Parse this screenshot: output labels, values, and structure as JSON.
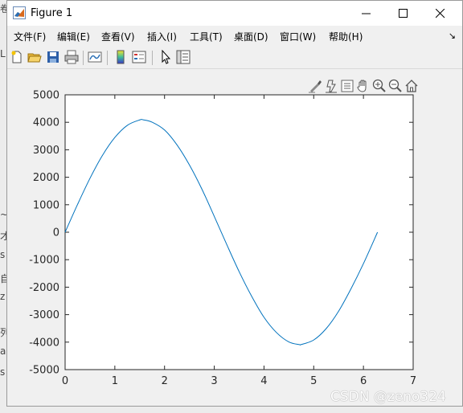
{
  "window": {
    "title": "Figure 1"
  },
  "menu": [
    {
      "label": "文件(F)"
    },
    {
      "label": "编辑(E)"
    },
    {
      "label": "查看(V)"
    },
    {
      "label": "插入(I)"
    },
    {
      "label": "工具(T)"
    },
    {
      "label": "桌面(D)"
    },
    {
      "label": "窗口(W)"
    },
    {
      "label": "帮助(H)"
    }
  ],
  "toolbar_icons": [
    "new-figure-icon",
    "open-file-icon",
    "save-icon",
    "print-icon",
    "link-plot-icon",
    "insert-colorbar-icon",
    "insert-legend-icon",
    "pointer-icon",
    "property-inspector-icon"
  ],
  "axes_toolbar_icons": [
    "brush-icon",
    "data-tips-icon",
    "restore-view-icon",
    "pan-icon",
    "zoom-in-icon",
    "zoom-out-icon",
    "home-icon"
  ],
  "colors": {
    "line": "#0072bd",
    "axes_bg": "#ffffff",
    "figure_bg": "#f0f0f0",
    "axis": "#262626"
  },
  "watermark": "CSDN @zeno324",
  "chart_data": {
    "type": "line",
    "xlim": [
      0,
      7
    ],
    "ylim": [
      -5000,
      5000
    ],
    "x_ticks": [
      0,
      1,
      2,
      3,
      4,
      5,
      6,
      7
    ],
    "y_ticks": [
      5000,
      4000,
      3000,
      2000,
      1000,
      0,
      -1000,
      -2000,
      -3000,
      -4000,
      -5000
    ],
    "x_tick_labels": [
      "0",
      "1",
      "2",
      "3",
      "4",
      "5",
      "6",
      "7"
    ],
    "y_tick_labels": [
      "5000",
      "4000",
      "3000",
      "2000",
      "1000",
      "0",
      "-1000",
      "-2000",
      "-3000",
      "-4000",
      "-5000"
    ],
    "grid": false,
    "series": [
      {
        "color": "#0072bd",
        "x": [
          0,
          0.25,
          0.5,
          0.75,
          1.0,
          1.25,
          1.5,
          1.571,
          1.75,
          2.0,
          2.25,
          2.5,
          2.75,
          3.0,
          3.25,
          3.5,
          3.75,
          4.0,
          4.25,
          4.5,
          4.712,
          4.75,
          5.0,
          5.25,
          5.5,
          5.75,
          6.0,
          6.283
        ],
        "y": [
          0,
          1010,
          1961,
          2792,
          3447,
          3888,
          4086,
          4090,
          4005,
          3720,
          3178,
          2448,
          1572,
          577,
          -445,
          -1435,
          -2326,
          -3096,
          -3649,
          -3993,
          -4090,
          -4087,
          -3922,
          -3509,
          -2876,
          -2058,
          -1143,
          0
        ]
      }
    ]
  }
}
